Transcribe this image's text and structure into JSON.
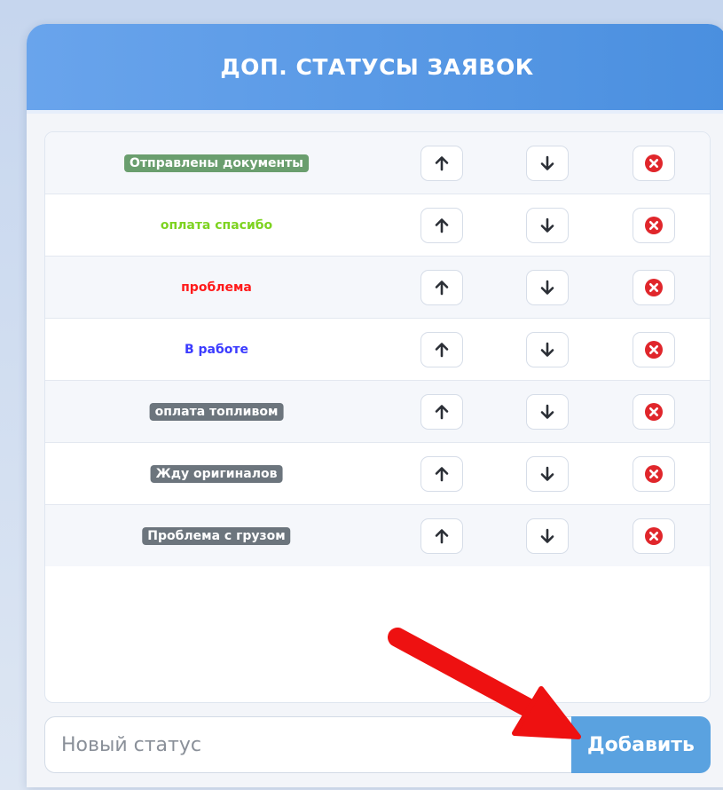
{
  "card": {
    "title": "ДОП. СТАТУСЫ ЗАЯВОК"
  },
  "statuses": [
    {
      "label": "Отправлены документы",
      "style": "badge",
      "color": "#6a9e6e"
    },
    {
      "label": "оплата спасибо",
      "style": "text",
      "color": "#7ed321"
    },
    {
      "label": "проблема",
      "style": "text",
      "color": "#ff1a1a"
    },
    {
      "label": "В работе",
      "style": "text",
      "color": "#3b3bff"
    },
    {
      "label": "оплата топливом",
      "style": "badge",
      "color": "#6c757d"
    },
    {
      "label": "Жду оригиналов",
      "style": "badge",
      "color": "#6c757d"
    },
    {
      "label": "Проблема с грузом",
      "style": "badge",
      "color": "#6c757d"
    }
  ],
  "icons": {
    "up": "arrow-up-icon",
    "down": "arrow-down-icon",
    "delete": "close-circle-icon"
  },
  "input": {
    "value": "",
    "placeholder": "Новый статус"
  },
  "add_button": {
    "label": "Добавить"
  },
  "colors": {
    "header": "#5a9ae6",
    "add_button": "#5aa2e0",
    "delete_icon": "#e0262b",
    "annotation_arrow": "#ee1111"
  }
}
